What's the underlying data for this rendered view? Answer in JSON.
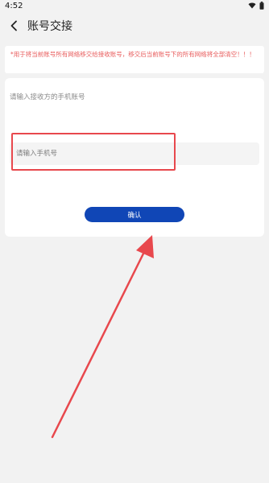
{
  "status_bar": {
    "time": "4:52"
  },
  "header": {
    "title": "账号交接",
    "back_icon": "chevron-left-icon"
  },
  "notice": {
    "text": "*用于将当前账号所有网络移交给接收账号，移交后当前账号下的所有网络将全部清空！！！"
  },
  "form": {
    "label": "请输入接收方的手机账号",
    "phone_placeholder": "请输入手机号",
    "phone_value": "",
    "confirm_label": "确认"
  },
  "colors": {
    "accent": "#1046b6",
    "notice_text": "#e85b5b",
    "annotation": "#e8484d"
  }
}
